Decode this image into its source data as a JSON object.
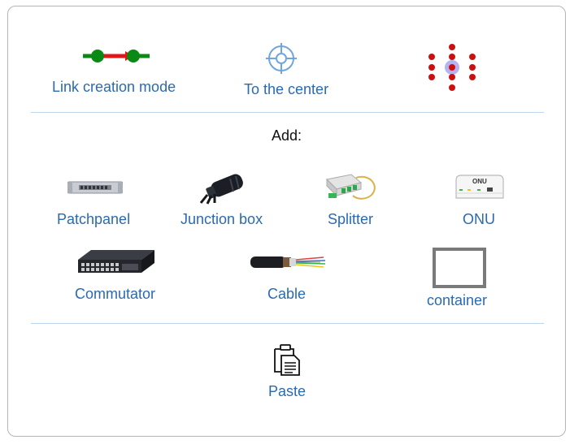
{
  "colors": {
    "label": "#2a6ab0",
    "divider": "#bcd6ee",
    "link_line_green": "#0a8a14",
    "link_arrow_red": "#e01818",
    "target_blue": "#6fa6dd",
    "grid_dot_red": "#cc1010",
    "grid_highlight": "#b6b3f2",
    "container_border": "#7a7a7a"
  },
  "top_tools": [
    {
      "label": "Link creation mode",
      "icon": "link-creation-icon"
    },
    {
      "label": "To the center",
      "icon": "crosshair-icon"
    },
    {
      "label": "",
      "icon": "dot-grid-icon"
    }
  ],
  "add": {
    "heading": "Add:",
    "items": [
      {
        "label": "Patchpanel",
        "icon": "patchpanel-icon"
      },
      {
        "label": "Junction box",
        "icon": "junction-box-icon"
      },
      {
        "label": "Splitter",
        "icon": "splitter-icon"
      },
      {
        "label": "ONU",
        "icon": "onu-icon",
        "device_text": "ONU"
      },
      {
        "label": "Commutator",
        "icon": "switch-icon"
      },
      {
        "label": "Cable",
        "icon": "fiber-cable-icon"
      },
      {
        "label": "container",
        "icon": "container-icon"
      }
    ]
  },
  "paste": {
    "label": "Paste",
    "icon": "clipboard-icon"
  }
}
